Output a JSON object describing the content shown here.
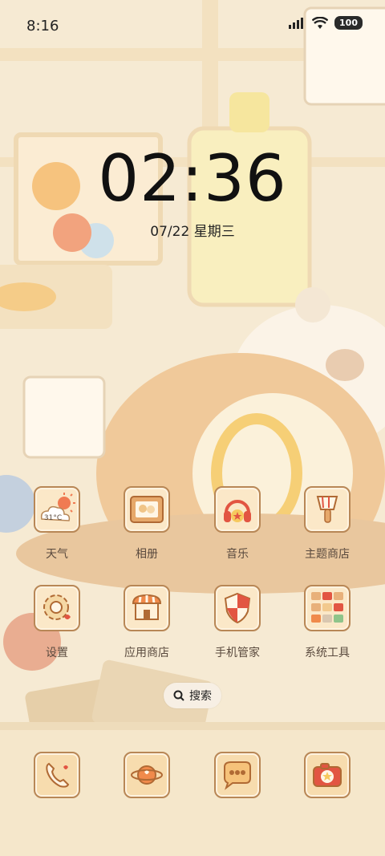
{
  "status_bar": {
    "time": "8:16",
    "battery": "100"
  },
  "lock": {
    "clock": "02:36",
    "date": "07/22 星期三"
  },
  "apps": {
    "weather": {
      "label": "天气",
      "temp": "31°C"
    },
    "gallery": {
      "label": "相册"
    },
    "music": {
      "label": "音乐"
    },
    "themes": {
      "label": "主题商店"
    },
    "settings": {
      "label": "设置"
    },
    "appstore": {
      "label": "应用商店"
    },
    "security": {
      "label": "手机管家"
    },
    "tools": {
      "label": "系统工具"
    }
  },
  "search": {
    "label": "搜索"
  },
  "dock": [
    "phone-icon",
    "browser-icon",
    "messages-icon",
    "camera-icon"
  ]
}
